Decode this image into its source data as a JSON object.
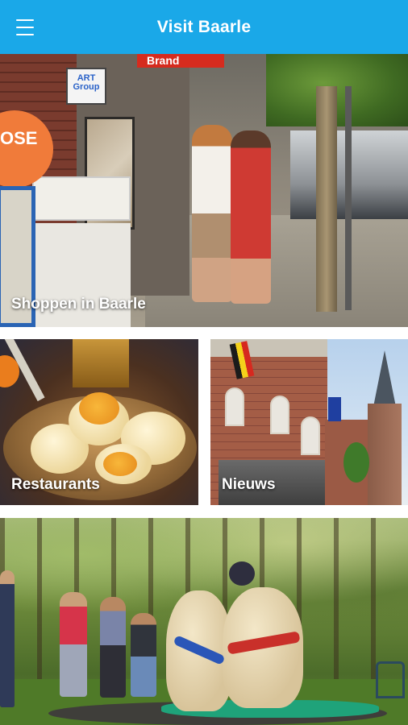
{
  "app_bar": {
    "title": "Visit Baarle",
    "menu_icon": "hamburger-menu-icon",
    "background_color": "#1aa8e8"
  },
  "tiles": [
    {
      "label": "Shoppen in Baarle",
      "image": "shopping-street-photo"
    },
    {
      "label": "Restaurants",
      "image": "dumplings-dish-photo"
    },
    {
      "label": "Nieuws",
      "image": "town-hall-photo"
    },
    {
      "label": "",
      "image": "sumo-wrestling-event-photo"
    }
  ],
  "photo_text": {
    "shop_sign": "Brand",
    "art_sign": "ART Group",
    "orange_sign": "OSE"
  }
}
